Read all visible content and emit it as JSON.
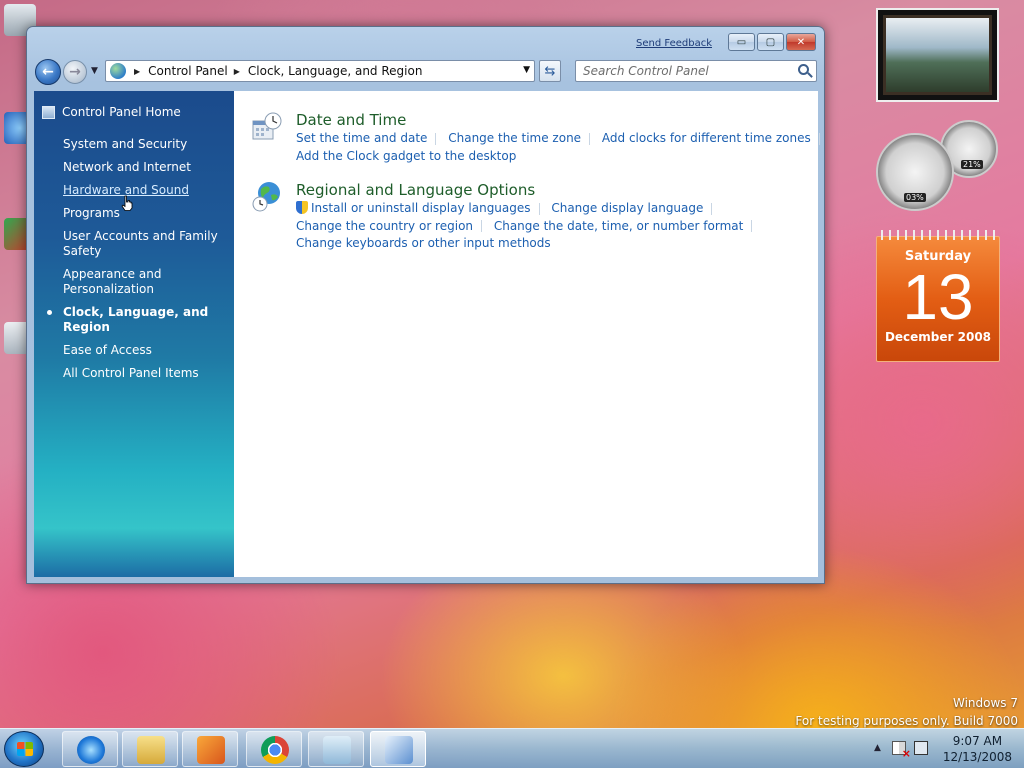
{
  "window": {
    "send_feedback": "Send Feedback",
    "minimize": "▭",
    "maximize": "▢",
    "close": "✕"
  },
  "nav": {
    "breadcrumbs": [
      "Control Panel",
      "Clock, Language, and Region"
    ],
    "search_placeholder": "Search Control Panel"
  },
  "sidebar": {
    "home": "Control Panel Home",
    "items": [
      {
        "label": "System and Security"
      },
      {
        "label": "Network and Internet"
      },
      {
        "label": "Hardware and Sound",
        "state": "hover"
      },
      {
        "label": "Programs"
      },
      {
        "label": "User Accounts and Family Safety"
      },
      {
        "label": "Appearance and Personalization"
      },
      {
        "label": "Clock, Language, and Region",
        "state": "current"
      },
      {
        "label": "Ease of Access"
      },
      {
        "label": "All Control Panel Items"
      }
    ]
  },
  "sections": [
    {
      "title": "Date and Time",
      "icon": "clock-calendar-icon",
      "links": [
        [
          "Set the time and date",
          "Change the time zone",
          "Add clocks for different time zones"
        ],
        [
          "Add the Clock gadget to the desktop"
        ]
      ]
    },
    {
      "title": "Regional and Language Options",
      "icon": "globe-clock-icon",
      "links": [
        [
          "Install or uninstall display languages",
          "Change display language"
        ],
        [
          "Change the country or region",
          "Change the date, time, or number format"
        ],
        [
          "Change keyboards or other input methods"
        ]
      ]
    }
  ],
  "gadgets": {
    "cpu_meter_primary": "03%",
    "cpu_meter_secondary": "21%",
    "calendar": {
      "day": "Saturday",
      "date": "13",
      "month": "December 2008"
    }
  },
  "watermark": {
    "line1": "Windows 7",
    "line2": "For testing purposes only. Build 7000"
  },
  "taskbar": {
    "time": "9:07 AM",
    "date": "12/13/2008",
    "pinned": [
      "internet-explorer-icon",
      "windows-explorer-icon",
      "media-player-icon",
      "chrome-icon",
      "notepad-icon",
      "control-panel-icon"
    ]
  },
  "colors": {
    "link": "#1c5fb0",
    "section_title": "#1e5d2a",
    "sidebar_top": "#1b4b8c",
    "calendar": "#e35e14"
  }
}
